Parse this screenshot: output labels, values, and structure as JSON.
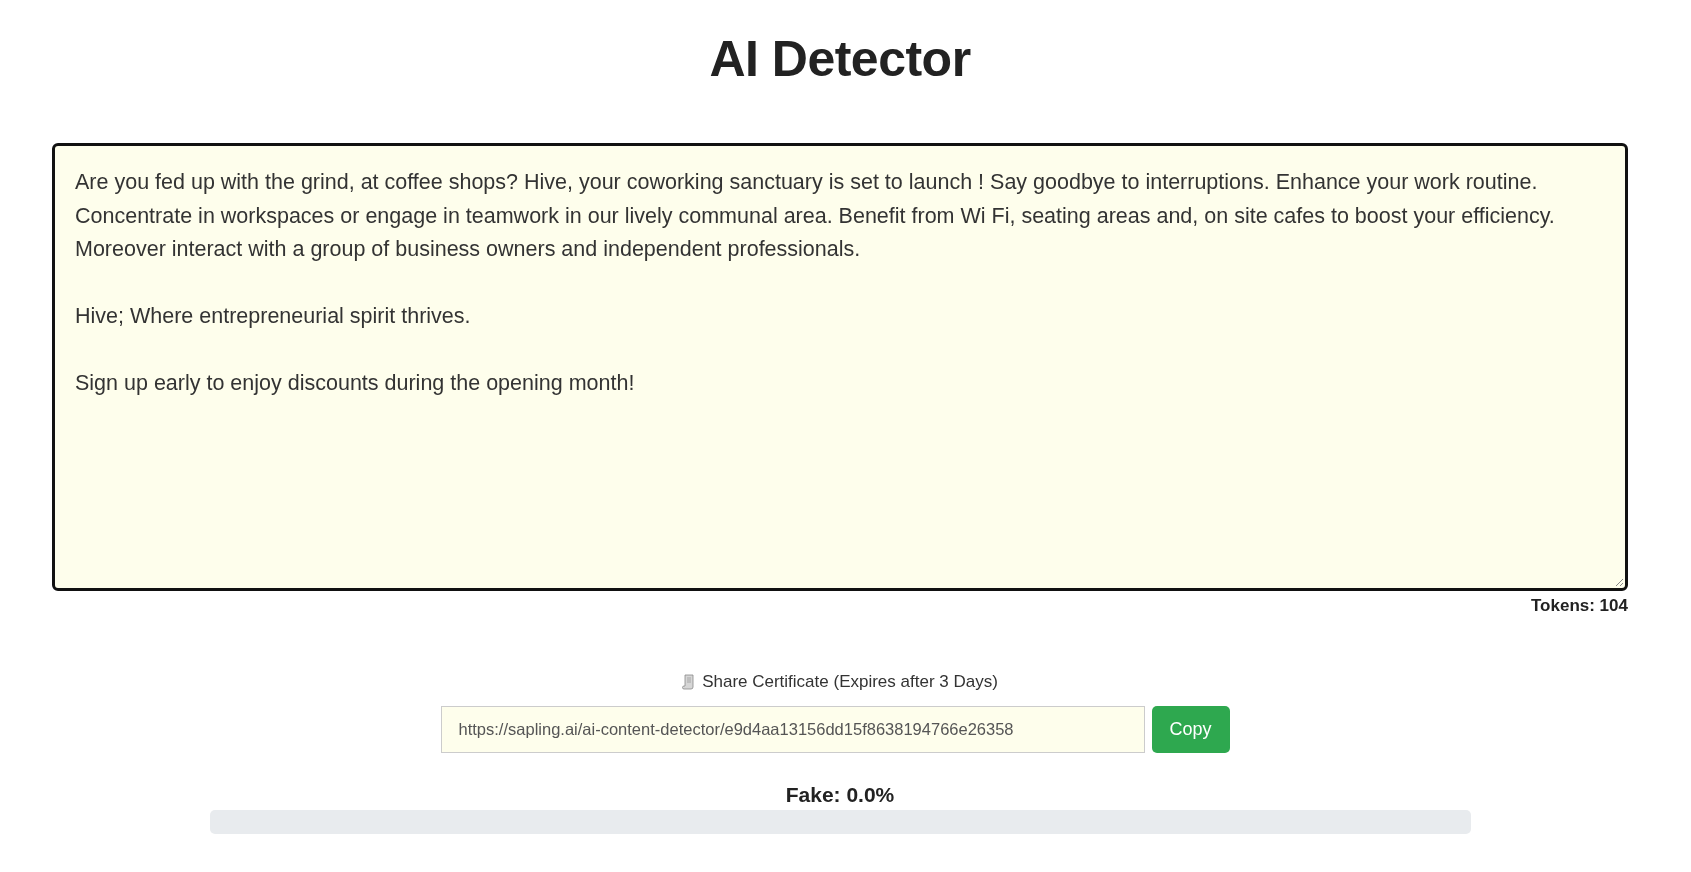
{
  "title": "AI Detector",
  "editor": {
    "paragraphs": [
      "Are you fed up with the grind, at coffee shops? Hive, your coworking sanctuary is set to launch ! Say goodbye to interruptions. Enhance your work routine. Concentrate in workspaces or engage in teamwork in our lively communal area. Benefit from Wi Fi, seating areas and, on site cafes to boost your efficiency. Moreover interact with a group of business owners and independent professionals.",
      "Hive; Where entrepreneurial spirit thrives.",
      "Sign up early to enjoy discounts during the opening month!"
    ]
  },
  "tokens": "Tokens: 104",
  "share": {
    "label": "Share Certificate (Expires after 3 Days)",
    "url": "https://sapling.ai/ai-content-detector/e9d4aa13156dd15f8638194766e26358",
    "button": "Copy"
  },
  "result": {
    "label": "Fake: 0.0%",
    "level": 0
  }
}
